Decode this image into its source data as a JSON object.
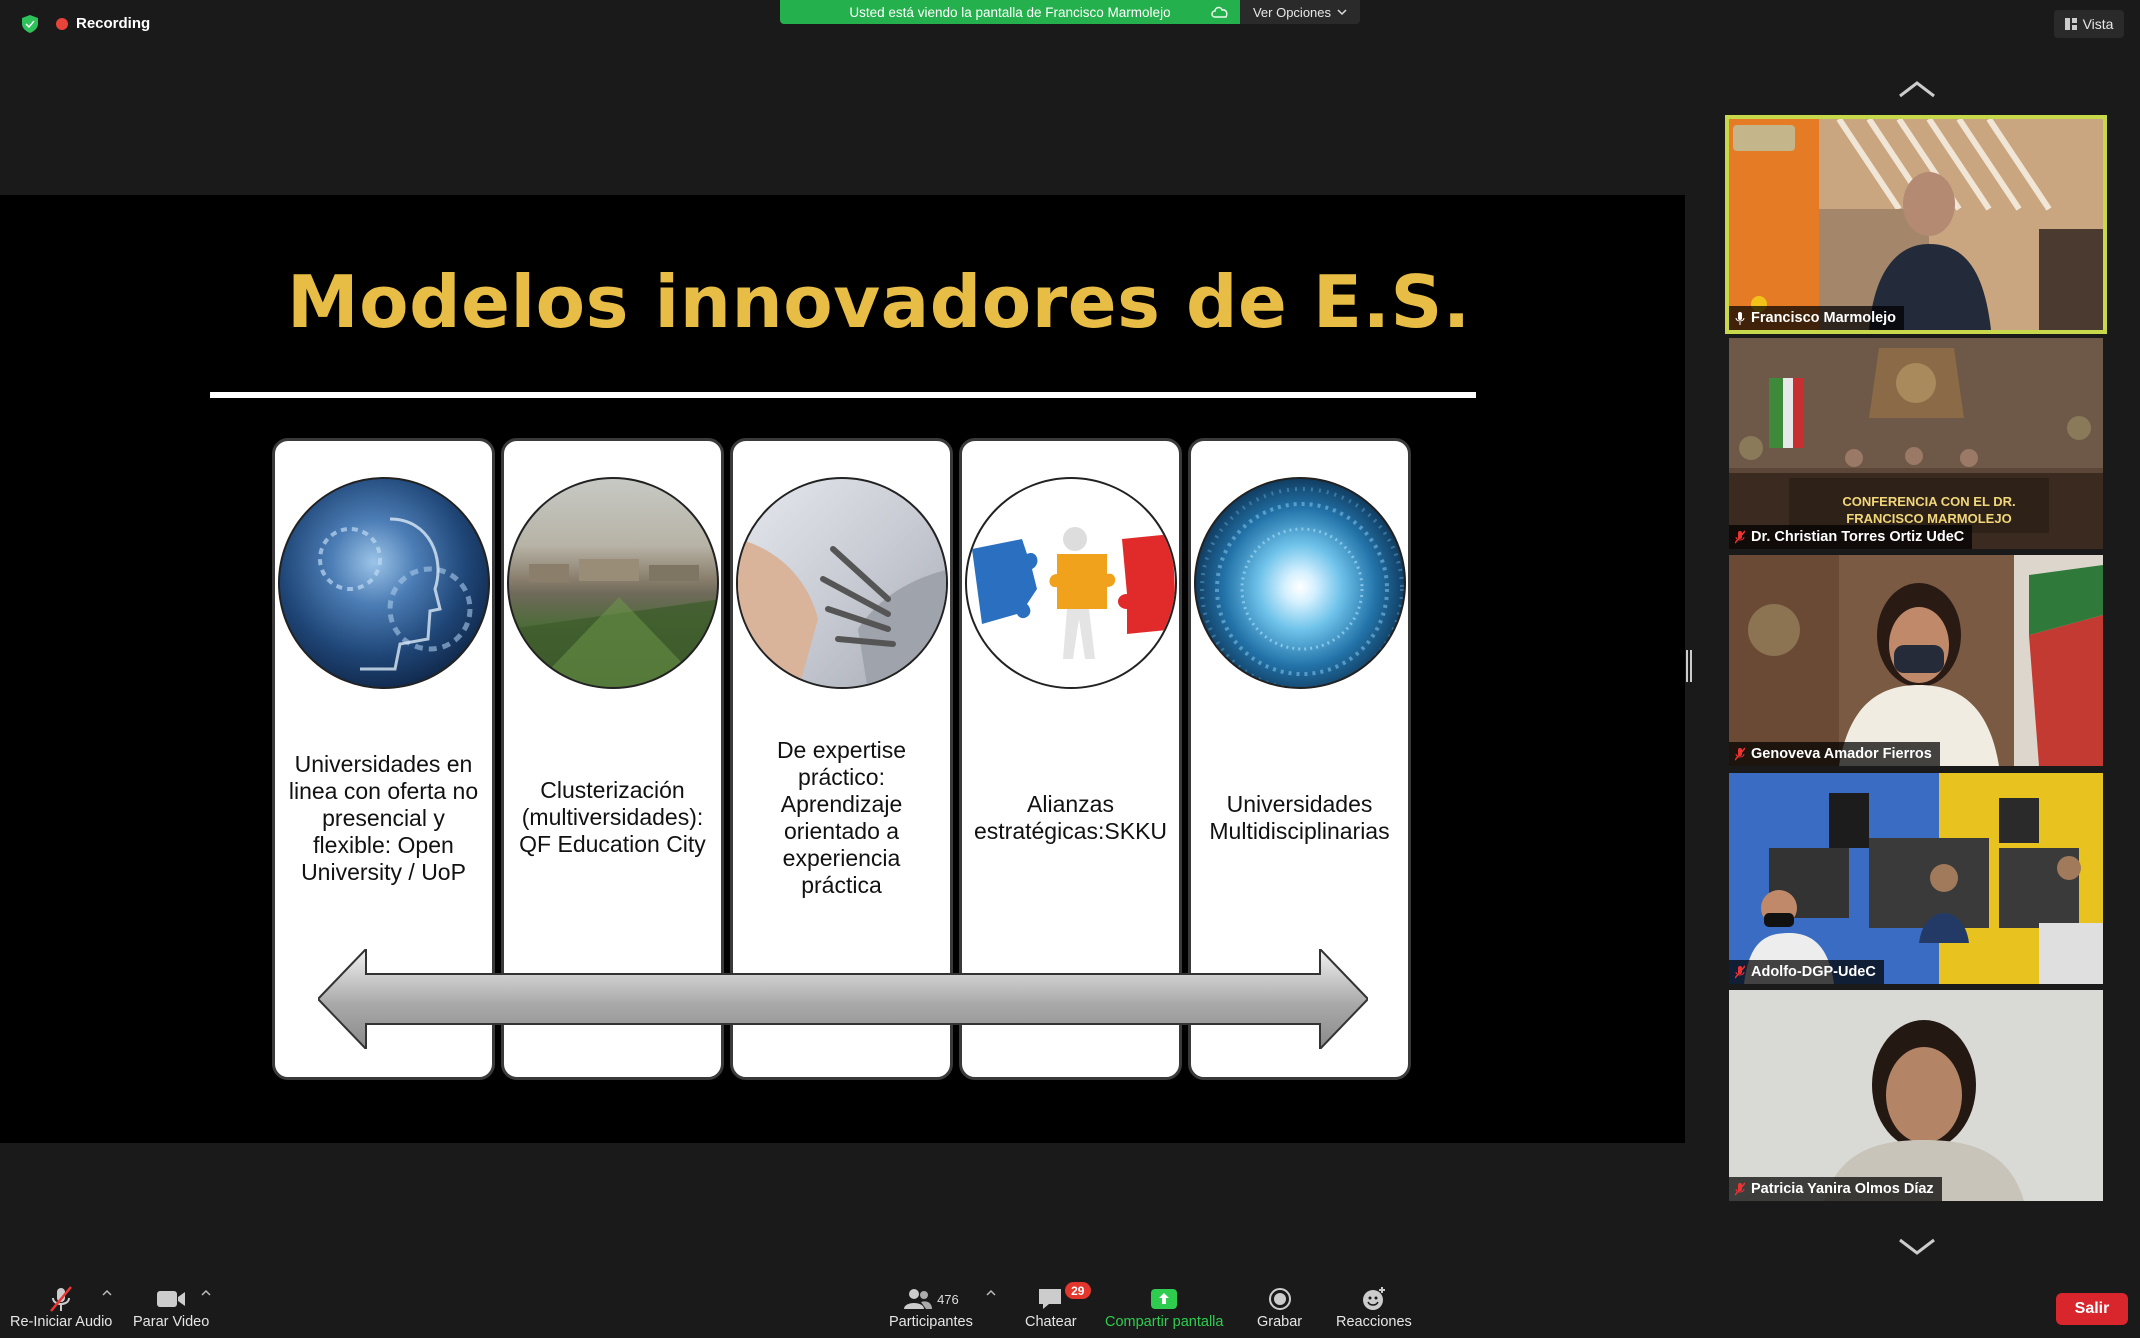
{
  "top_bar": {
    "recording_label": "Recording",
    "share_banner": "Usted está viendo la pantalla de Francisco Marmolejo",
    "view_options_label": "Ver Opciones",
    "vista_label": "Vista"
  },
  "slide": {
    "title": "Modelos innovadores de E.S.",
    "columns": [
      {
        "text": "Universidades en linea con oferta no presencial y flexible: Open University / UoP",
        "image": "technology-head-image"
      },
      {
        "text": "Clusterización (multiversidades): QF Education City",
        "image": "campus-aerial-image"
      },
      {
        "text": "De expertise práctico: Aprendizaje orientado a experiencia práctica",
        "image": "robot-hand-image"
      },
      {
        "text": "Alianzas estratégicas:SKKU",
        "image": "puzzle-pieces-image"
      },
      {
        "text": "Universidades Multidisciplinarias",
        "image": "data-tunnel-image"
      }
    ]
  },
  "participants_gallery": [
    {
      "name": "Francisco Marmolejo",
      "active_speaker": true,
      "muted": false
    },
    {
      "name": "Dr. Christian Torres Ortiz UdeC",
      "active_speaker": false,
      "muted": true,
      "overlay_text": "CONFERENCIA CON EL DR. FRANCISCO MARMOLEJO"
    },
    {
      "name": "Genoveva Amador Fierros",
      "active_speaker": false,
      "muted": true
    },
    {
      "name": "Adolfo-DGP-UdeC",
      "active_speaker": false,
      "muted": true
    },
    {
      "name": "Patricia Yanira Olmos Díaz",
      "active_speaker": false,
      "muted": true
    }
  ],
  "toolbar": {
    "audio_label": "Re-Iniciar Audio",
    "video_label": "Parar Video",
    "participants_label": "Participantes",
    "participants_count": "476",
    "chat_label": "Chatear",
    "chat_badge": "29",
    "share_label": "Compartir pantalla",
    "record_label": "Grabar",
    "reactions_label": "Reacciones",
    "leave_label": "Salir"
  },
  "colors": {
    "share_green": "#24b04c",
    "title_gold": "#e8bd45",
    "active_border": "#c7d84a",
    "leave_red": "#d8262c",
    "recording_red": "#e8433a"
  }
}
